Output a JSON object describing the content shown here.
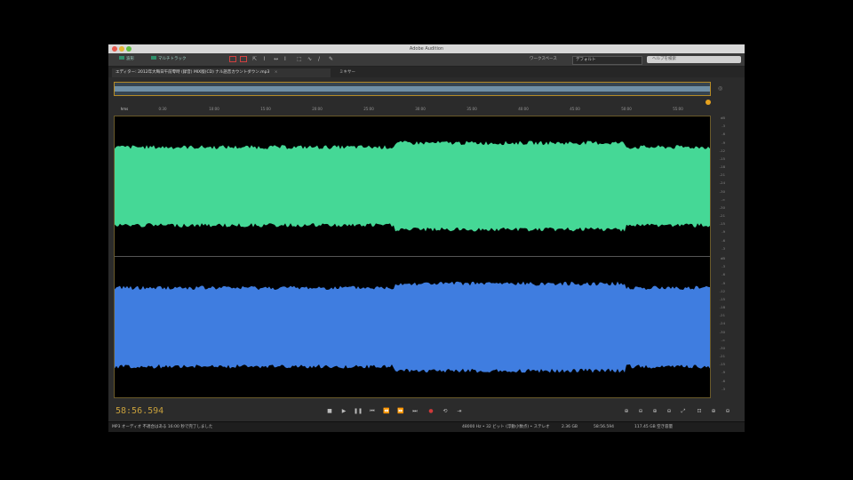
{
  "app": {
    "title": "Adobe Audition"
  },
  "toolbar": {
    "waveform_label": "波形",
    "multitrack_label": "マルチトラック",
    "workspace_label": "ワークスペース",
    "workspace_value": "デフォルト",
    "search_placeholder": "ヘルプを検索"
  },
  "tabs": [
    {
      "label": "エディター: 2012年大晦日午前零時 (録音) MIX版(CD) ナル語音カウントダウン.mp3"
    },
    {
      "label": "ミキサー"
    }
  ],
  "ruler": {
    "unit": "hms",
    "ticks": [
      "0:30",
      "10:00",
      "15:00",
      "20:00",
      "25:00",
      "30:00",
      "35:00",
      "40:00",
      "45:00",
      "50:00",
      "55:00"
    ]
  },
  "db_scale": {
    "top": [
      "dB",
      "-3",
      "-6",
      "-9",
      "-12",
      "-15",
      "-18",
      "-21",
      "-24",
      "-30",
      "-∞",
      "-30",
      "-21",
      "-15",
      "-9",
      "-6",
      "-3"
    ],
    "bottom": [
      "dB",
      "-3",
      "-6",
      "-9",
      "-12",
      "-15",
      "-18",
      "-21",
      "-24",
      "-30",
      "-∞",
      "-30",
      "-21",
      "-15",
      "-9",
      "-6",
      "-3"
    ]
  },
  "transport": {
    "timecode": "58:56.594"
  },
  "status": {
    "left": "MP3 オーディオ 不適合はある 16:00 秒で完了しました",
    "sample_info": "48000 Hz • 32 ビット (浮動小数点) • ステレオ",
    "size": "2.36 GB",
    "duration": "58:56.594",
    "free": "117.45 GB 空き容量"
  },
  "colors": {
    "channel_left": "#45d896",
    "channel_right": "#3f7de0",
    "accent": "#c8a03c"
  }
}
